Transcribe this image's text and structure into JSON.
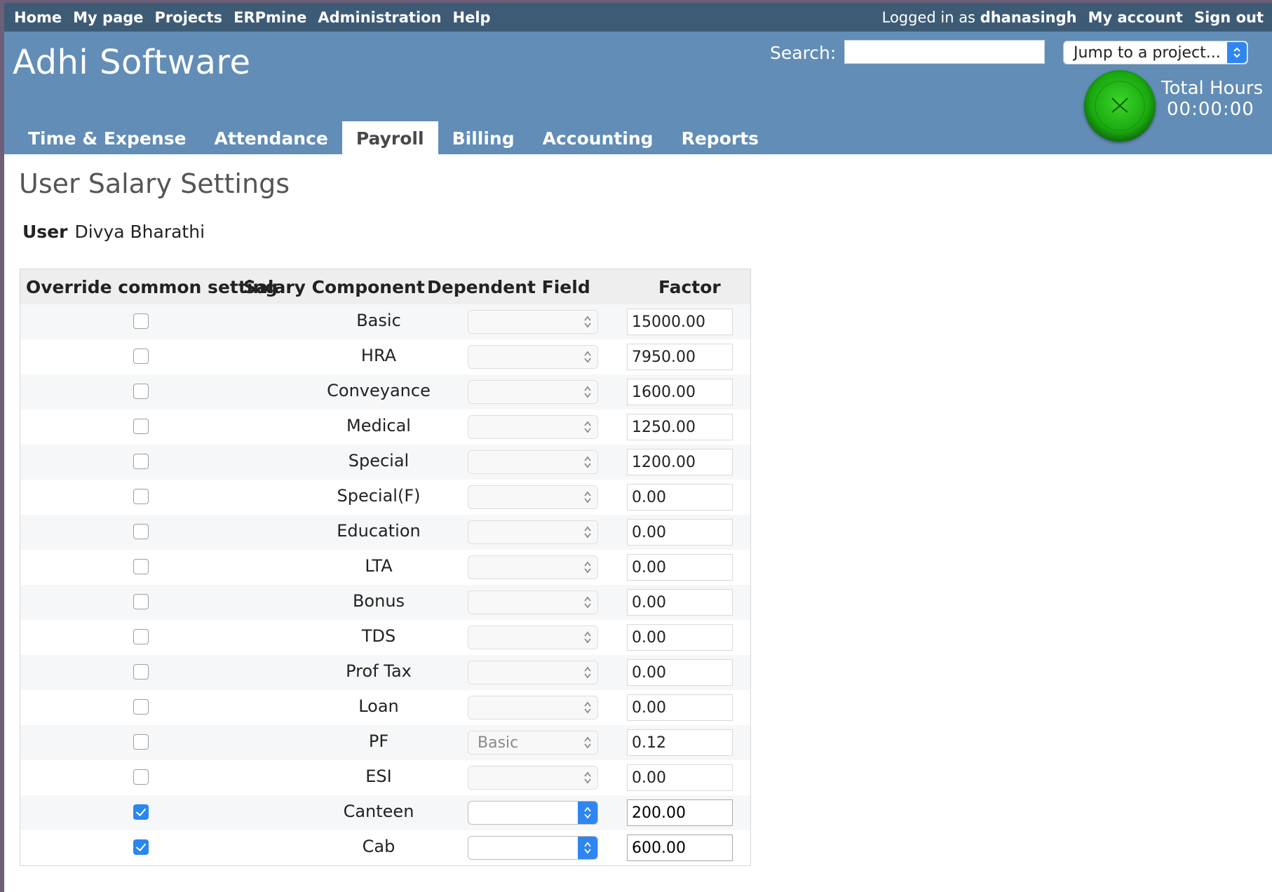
{
  "top_menu": {
    "links": [
      "Home",
      "My page",
      "Projects",
      "ERPmine",
      "Administration",
      "Help"
    ],
    "logged_in_prefix": "Logged in as",
    "username": "dhanasingh",
    "my_account": "My account",
    "sign_out": "Sign out"
  },
  "header": {
    "site_title": "Adhi Software",
    "search_label": "Search:",
    "search_value": "",
    "jump_select": "Jump to a project...",
    "total_hours_label": "Total Hours",
    "total_hours_value": "00:00:00"
  },
  "main_tabs": [
    {
      "label": "Time & Expense",
      "selected": false
    },
    {
      "label": "Attendance",
      "selected": false
    },
    {
      "label": "Payroll",
      "selected": true
    },
    {
      "label": "Billing",
      "selected": false
    },
    {
      "label": "Accounting",
      "selected": false
    },
    {
      "label": "Reports",
      "selected": false
    }
  ],
  "page": {
    "title": "User Salary Settings",
    "user_label": "User",
    "user_name": "Divya Bharathi"
  },
  "table": {
    "headers": [
      "Override common setting",
      "Salary Component",
      "Dependent Field",
      "Factor"
    ],
    "rows": [
      {
        "override": false,
        "component": "Basic",
        "dependent": "",
        "factor": "15000.00"
      },
      {
        "override": false,
        "component": "HRA",
        "dependent": "",
        "factor": "7950.00"
      },
      {
        "override": false,
        "component": "Conveyance",
        "dependent": "",
        "factor": "1600.00"
      },
      {
        "override": false,
        "component": "Medical",
        "dependent": "",
        "factor": "1250.00"
      },
      {
        "override": false,
        "component": "Special",
        "dependent": "",
        "factor": "1200.00"
      },
      {
        "override": false,
        "component": "Special(F)",
        "dependent": "",
        "factor": "0.00"
      },
      {
        "override": false,
        "component": "Education",
        "dependent": "",
        "factor": "0.00"
      },
      {
        "override": false,
        "component": "LTA",
        "dependent": "",
        "factor": "0.00"
      },
      {
        "override": false,
        "component": "Bonus",
        "dependent": "",
        "factor": "0.00"
      },
      {
        "override": false,
        "component": "TDS",
        "dependent": "",
        "factor": "0.00"
      },
      {
        "override": false,
        "component": "Prof Tax",
        "dependent": "",
        "factor": "0.00"
      },
      {
        "override": false,
        "component": "Loan",
        "dependent": "",
        "factor": "0.00"
      },
      {
        "override": false,
        "component": "PF",
        "dependent": "Basic",
        "factor": "0.12"
      },
      {
        "override": false,
        "component": "ESI",
        "dependent": "",
        "factor": "0.00"
      },
      {
        "override": true,
        "component": "Canteen",
        "dependent": "",
        "factor": "200.00"
      },
      {
        "override": true,
        "component": "Cab",
        "dependent": "",
        "factor": "600.00"
      }
    ]
  },
  "colors": {
    "top_bar": "#3e5b76",
    "header": "#628db6",
    "accent": "#2f86f0",
    "timer": "#1aa90f"
  },
  "icons": {
    "timer": "green-clock-icon",
    "select_arrows": "up-down-chevron-icon",
    "checkbox_checked": "checkmark-icon"
  }
}
